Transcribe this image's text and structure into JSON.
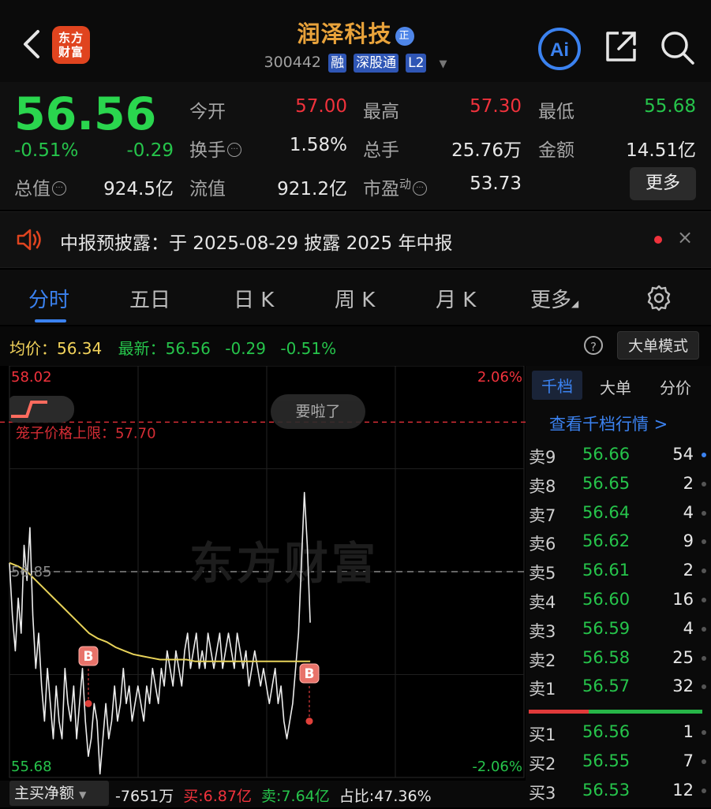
{
  "header": {
    "logo_text": "东方财富",
    "stock_name": "润泽科技",
    "name_badge": "正",
    "code": "300442",
    "tags": [
      "融",
      "深股通",
      "L2"
    ],
    "ai_label": "Ai"
  },
  "quote": {
    "price": "56.56",
    "change_pct": "-0.51%",
    "change": "-0.29",
    "fields": {
      "open": {
        "label": "今开",
        "value": "57.00"
      },
      "high": {
        "label": "最高",
        "value": "57.30"
      },
      "low": {
        "label": "最低",
        "value": "55.68"
      },
      "turnover": {
        "label": "换手",
        "value": "1.58%"
      },
      "volume": {
        "label": "总手",
        "value": "25.76万"
      },
      "amount": {
        "label": "金额",
        "value": "14.51亿"
      },
      "market_cap": {
        "label": "总值",
        "value": "924.5亿"
      },
      "float_cap": {
        "label": "流值",
        "value": "921.2亿"
      },
      "pe": {
        "label": "市盈",
        "sup": "动",
        "value": "53.73"
      }
    },
    "more_label": "更多"
  },
  "notice": {
    "text": "中报预披露：于 2025-08-29 披露 2025 年中报",
    "close": "×"
  },
  "tabs": [
    "分时",
    "五日",
    "日 K",
    "周 K",
    "月 K",
    "更多"
  ],
  "chart_header": {
    "avg_label": "均价：",
    "avg_value": "56.34",
    "latest_label": "最新：",
    "latest_value": "56.56",
    "latest_change": "-0.29",
    "latest_pct": "-0.51%",
    "help": "?",
    "bigorder_btn": "大单模式"
  },
  "chart_data": {
    "type": "line",
    "title": "",
    "y_top": "58.02",
    "y_bottom": "55.68",
    "pct_top": "2.06%",
    "pct_bottom": "-2.06%",
    "prev_close": "56.85",
    "ylim": [
      55.68,
      58.02
    ],
    "limit_label": "笼子价格上限：57.70",
    "limit_value": 57.7,
    "watermark": "东方财富",
    "bubble_text": "要啦了",
    "minutes_total": 240,
    "series": [
      {
        "values": [
          56.9,
          56.6,
          56.4,
          56.7,
          56.5,
          57.0,
          56.8,
          57.1,
          56.6,
          56.3,
          56.5,
          56.2,
          56.0,
          56.3,
          56.1,
          55.9,
          56.2,
          56.0,
          55.9,
          56.3,
          56.1,
          56.0,
          56.2,
          55.9,
          56.1,
          56.3,
          56.0,
          55.8,
          55.9,
          56.1,
          56.0,
          55.7,
          55.9,
          56.1,
          55.9,
          56.0,
          56.2,
          56.0,
          56.1,
          56.3,
          56.1,
          56.2,
          56.0,
          56.1,
          56.2,
          56.1,
          56.0,
          56.2,
          56.1,
          56.3,
          56.2,
          56.1,
          56.3,
          56.2,
          56.4,
          56.3,
          56.2,
          56.4,
          56.3,
          56.2,
          56.4,
          56.5,
          56.3,
          56.4,
          56.5,
          56.3,
          56.4,
          56.3,
          56.5,
          56.4,
          56.3,
          56.4,
          56.5,
          56.3,
          56.4,
          56.5,
          56.4,
          56.3,
          56.5,
          56.4,
          56.3,
          56.4,
          56.2,
          56.3,
          56.4,
          56.3,
          56.2,
          56.3,
          56.2,
          56.1,
          56.2,
          56.3,
          56.1,
          56.2,
          56.0,
          55.9,
          56.0,
          56.1,
          56.3,
          56.5,
          56.9,
          57.3,
          57.0,
          56.56
        ]
      },
      {
        "values": [
          56.9,
          56.88,
          56.85,
          56.8,
          56.75,
          56.7,
          56.65,
          56.6,
          56.55,
          56.5,
          56.47,
          56.45,
          56.42,
          56.4,
          56.38,
          56.37,
          56.36,
          56.35,
          56.35,
          56.35,
          56.35,
          56.34,
          56.34,
          56.34,
          56.34,
          56.34,
          56.34,
          56.34,
          56.34,
          56.34,
          56.34,
          56.34,
          56.34,
          56.34,
          56.34
        ]
      }
    ],
    "markers": [
      {
        "label": "B",
        "value": 56.1
      },
      {
        "label": "B",
        "value": 56.0
      }
    ]
  },
  "order_book": {
    "tabs": [
      "千档",
      "大单",
      "分价"
    ],
    "link": "查看千档行情 >",
    "asks": [
      {
        "label": "卖9",
        "price": "56.66",
        "vol": "54"
      },
      {
        "label": "卖8",
        "price": "56.65",
        "vol": "2"
      },
      {
        "label": "卖7",
        "price": "56.64",
        "vol": "4"
      },
      {
        "label": "卖6",
        "price": "56.62",
        "vol": "9"
      },
      {
        "label": "卖5",
        "price": "56.61",
        "vol": "2"
      },
      {
        "label": "卖4",
        "price": "56.60",
        "vol": "16"
      },
      {
        "label": "卖3",
        "price": "56.59",
        "vol": "4"
      },
      {
        "label": "卖2",
        "price": "56.58",
        "vol": "25"
      },
      {
        "label": "卖1",
        "price": "56.57",
        "vol": "32"
      }
    ],
    "bids": [
      {
        "label": "买1",
        "price": "56.56",
        "vol": "1"
      },
      {
        "label": "买2",
        "price": "56.55",
        "vol": "7"
      },
      {
        "label": "买3",
        "price": "56.53",
        "vol": "12"
      }
    ]
  },
  "footer": {
    "net_btn": "主买净额",
    "net_value": "-7651万",
    "buy_label": "买:",
    "buy_value": "6.87亿",
    "sell_label": "卖:",
    "sell_value": "7.64亿",
    "ratio_label": "占比:",
    "ratio_value": "47.36%"
  },
  "colors": {
    "up": "#f0323c",
    "down": "#26c44b",
    "avg_line": "#e8d35a",
    "accent": "#3b82f0",
    "brand": "#e0441f"
  }
}
